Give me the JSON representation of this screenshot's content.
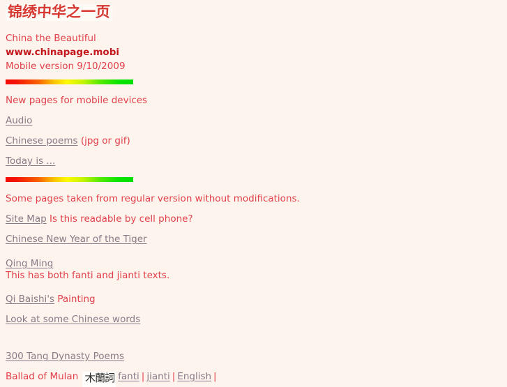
{
  "banner": {
    "image_alt": "jin-xiu-zhong-hua-zhi-yi-ye-banner",
    "text": "锦绣中华之一页"
  },
  "header": {
    "site_title": "China the Beautiful",
    "site_url": "www.chinapage.mobi",
    "version_line": "Mobile version 9/10/2009"
  },
  "section1": {
    "heading": "New pages for mobile devices",
    "links": [
      {
        "label": "Audio",
        "suffix": ""
      },
      {
        "label": "Chinese poems",
        "suffix": " (jpg or gif)"
      },
      {
        "label": "Today is ...",
        "suffix": ""
      }
    ]
  },
  "section2": {
    "note": "Some pages taken from regular version without modifications.",
    "site_map_link": "Site Map",
    "site_map_note": " Is this readable by cell phone?",
    "tiger_link": "Chinese New Year of the Tiger",
    "qingming_link": "Qing Ming",
    "qingming_note": "This has both fanti and jianti texts.",
    "qibaishi_link": "Qi Baishi's",
    "qibaishi_note": " Painting",
    "chinese_words_link": "Look at some Chinese words"
  },
  "section3": {
    "tang_poems_link": "300 Tang Dynasty Poems",
    "mulan_label": "Ballad of Mulan",
    "mulan_cjk": "木蘭詞",
    "mulan_links": [
      {
        "label": "fanti"
      },
      {
        "label": "jianti"
      },
      {
        "label": "English"
      }
    ],
    "separator": "|"
  },
  "colors": {
    "background": "#fdf4ee",
    "red_text": "#e2404a",
    "bold_red": "#c4161c",
    "link": "#8a7a87",
    "banner_red": "#d63a32"
  }
}
